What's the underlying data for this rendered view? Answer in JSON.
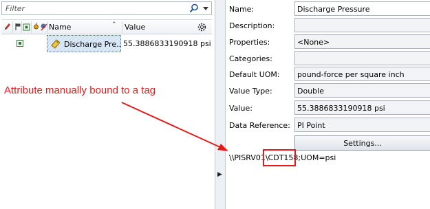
{
  "filter": {
    "placeholder": "Filter"
  },
  "columns": {
    "name": "Name",
    "value": "Value"
  },
  "attribute_row": {
    "name": "Discharge Pre...",
    "value": "55.3886833190918 psi"
  },
  "annotation": {
    "text": "Attribute manually bound to a tag",
    "color": "#e41b1b"
  },
  "properties": {
    "name": {
      "label": "Name:",
      "value": "Discharge Pressure"
    },
    "description": {
      "label": "Description:",
      "value": ""
    },
    "properties": {
      "label": "Properties:",
      "value": "<None>"
    },
    "categories": {
      "label": "Categories:",
      "value": ""
    },
    "default_uom": {
      "label": "Default UOM:",
      "value": "pound-force per square inch"
    },
    "value_type": {
      "label": "Value Type:",
      "value": "Double"
    },
    "value": {
      "label": "Value:",
      "value": "55.3886833190918 psi"
    },
    "data_reference": {
      "label": "Data Reference:",
      "value": "PI Point"
    }
  },
  "settings_button": {
    "label": "Settings..."
  },
  "config_string": {
    "part1": "\\\\PISRV01\\",
    "tag": "CDT158",
    "part2": ";UOM=psi"
  },
  "icons": [
    "edit-icon",
    "flag-icon",
    "check-icon",
    "link-icon",
    "exclude-icon",
    "search-icon",
    "dropdown-icon",
    "gear-icon",
    "tag-icon",
    "splitter-arrow-icon"
  ]
}
